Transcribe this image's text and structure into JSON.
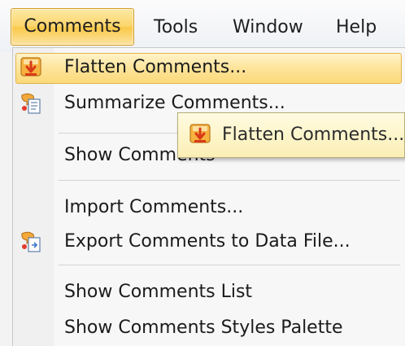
{
  "menubar": {
    "items": [
      "Comments",
      "Tools",
      "Window",
      "Help"
    ]
  },
  "dropdown": {
    "items": [
      {
        "label": "Flatten Comments...",
        "icon": "flatten-comments-icon",
        "highlighted": true
      },
      {
        "label": "Summarize Comments...",
        "icon": "summarize-comments-icon"
      },
      {
        "label": "Show Comments",
        "icon": null
      },
      {
        "label": "Import Comments...",
        "icon": null
      },
      {
        "label": "Export Comments to Data File...",
        "icon": "export-comments-icon"
      },
      {
        "label": "Show Comments List",
        "icon": null
      },
      {
        "label": "Show Comments Styles Palette",
        "icon": null
      }
    ]
  },
  "drag_ghost": {
    "label": "Flatten Comments...",
    "icon": "flatten-comments-icon"
  },
  "colors": {
    "active_menu": "#fbd56b",
    "highlight": "#fde49a",
    "accent_orange": "#e8661c"
  }
}
